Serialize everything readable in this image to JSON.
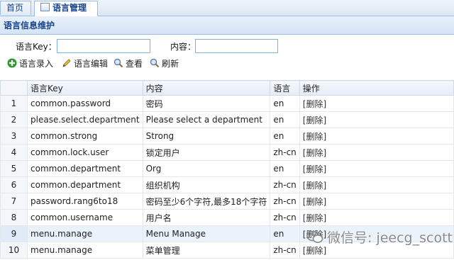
{
  "tabs": [
    {
      "label": "首页"
    },
    {
      "label": "语言管理",
      "close": "×"
    }
  ],
  "panel": {
    "title": "语言信息维护"
  },
  "search": {
    "key_label": "语言Key：",
    "key_value": "",
    "content_label": "内容：",
    "content_value": ""
  },
  "toolbar": {
    "add_label": "语言录入",
    "edit_label": "语言编辑",
    "view_label": "查看",
    "refresh_label": "刷新"
  },
  "grid": {
    "headers": {
      "num": "",
      "key": "语言Key",
      "content": "内容",
      "lang": "语言",
      "ops": "操作"
    },
    "rows": [
      {
        "num": "1",
        "key": "common.password",
        "content": "密码",
        "lang": "en",
        "op": "[删除]"
      },
      {
        "num": "2",
        "key": "please.select.department",
        "content": "Please select a department",
        "lang": "en",
        "op": "[删除]"
      },
      {
        "num": "3",
        "key": "common.strong",
        "content": "Strong",
        "lang": "en",
        "op": "[删除]"
      },
      {
        "num": "4",
        "key": "common.lock.user",
        "content": "锁定用户",
        "lang": "zh-cn",
        "op": "[删除]"
      },
      {
        "num": "5",
        "key": "common.department",
        "content": "Org",
        "lang": "en",
        "op": "[删除]"
      },
      {
        "num": "6",
        "key": "common.department",
        "content": "组织机构",
        "lang": "zh-cn",
        "op": "[删除]"
      },
      {
        "num": "7",
        "key": "password.rang6to18",
        "content": "密码至少6个字符,最多18个字符",
        "lang": "zh-cn",
        "op": "[删除]"
      },
      {
        "num": "8",
        "key": "common.username",
        "content": "用户名",
        "lang": "zh-cn",
        "op": "[删除]"
      },
      {
        "num": "9",
        "key": "menu.manage",
        "content": "Menu Manage",
        "lang": "en",
        "op": "[删除]"
      },
      {
        "num": "10",
        "key": "menu.manage",
        "content": "菜单管理",
        "lang": "zh-cn",
        "op": "[删除]"
      }
    ]
  },
  "watermark": {
    "text": "微信号: jeecg_scott"
  },
  "colors": {
    "accent": "#15428b",
    "border": "#99bbe8",
    "add_icon": "#2e9a2e",
    "selected_row": "#eaf2fc"
  },
  "icons": {
    "tab_doc": "document-icon",
    "add": "plus-circle-icon",
    "edit": "pencil-icon",
    "view": "magnifier-icon",
    "refresh": "magnifier-icon"
  }
}
